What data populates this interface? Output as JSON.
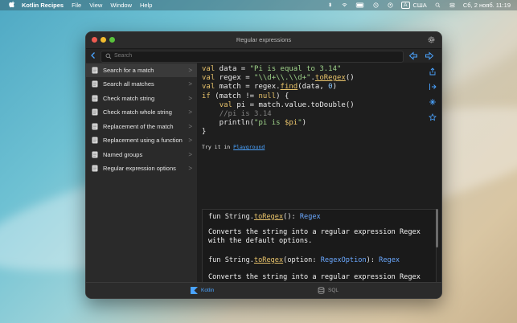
{
  "menubar": {
    "app_name": "Kotlin Recipes",
    "items": [
      "File",
      "View",
      "Window",
      "Help"
    ],
    "status": {
      "input_badge": "A",
      "input_lang": "США",
      "datetime": "Сб, 2 нояб. 11:19"
    }
  },
  "window": {
    "title": "Regular expressions",
    "search": {
      "placeholder": "Search"
    }
  },
  "sidebar": {
    "items": [
      {
        "label": "Search for a match",
        "selected": true
      },
      {
        "label": "Search all matches"
      },
      {
        "label": "Check match string"
      },
      {
        "label": "Check match whole string"
      },
      {
        "label": "Replacement of the match"
      },
      {
        "label": "Replacement using a function"
      },
      {
        "label": "Named groups"
      },
      {
        "label": "Regular expression options"
      }
    ],
    "chevron": ">"
  },
  "code": {
    "try_prefix": "Try it in",
    "try_link": "Playground"
  },
  "doc": {
    "sig1_prefix": "fun String.",
    "sig1_fn": "toRegex",
    "sig1_mid": "(): ",
    "sig1_type": "Regex",
    "desc1_l1": "Converts the string into a regular expression Regex",
    "desc1_l2": "with the default options.",
    "sig2_prefix": "fun String.",
    "sig2_fn": "toRegex",
    "sig2_param": "(option: ",
    "sig2_ptype": "RegexOption",
    "sig2_close": "): ",
    "sig2_type": "Regex",
    "desc2_l1": "Converts the string into a regular expression Regex"
  },
  "tabs": {
    "kotlin": "Kotlin",
    "sql": "SQL"
  },
  "colors": {
    "accent": "#4aa3ff",
    "keyword": "#e8c36b",
    "string": "#9fd38a"
  }
}
